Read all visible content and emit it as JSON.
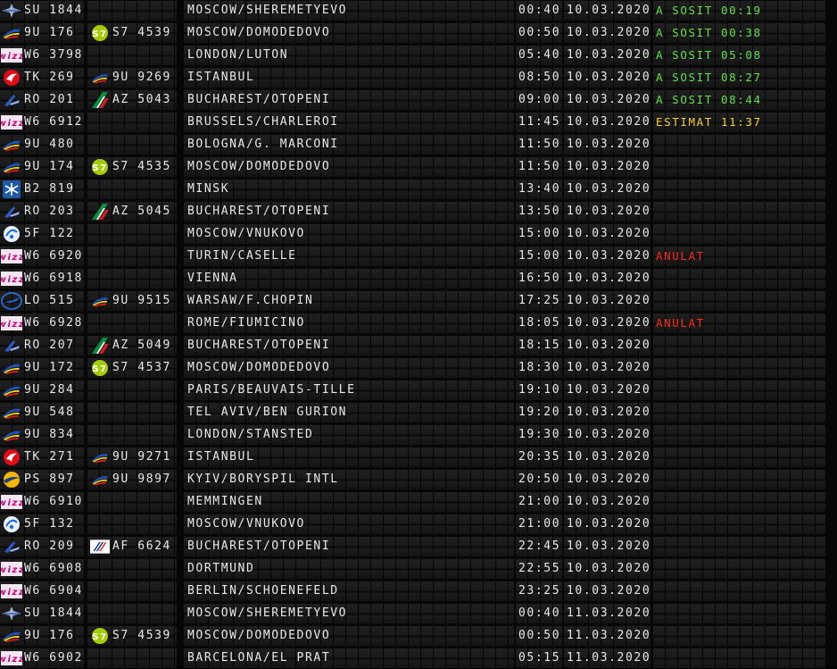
{
  "colors": {
    "text": "#e9e9e9",
    "status_landed": "#66e04a",
    "status_estimated": "#f2d23a",
    "status_cancelled": "#ff2a1a"
  },
  "flights": [
    {
      "flight": "SU 1844",
      "logo": "aeroflot-logo",
      "codeshare": "",
      "codeshare_logo": "",
      "destination": "MOSCOW/SHEREMETYEVO",
      "time": "00:40",
      "date": "10.03.2020",
      "status": "A SOSIT 00:19",
      "status_type": "landed"
    },
    {
      "flight": "9U 176",
      "logo": "air-moldova-logo",
      "codeshare": "S7 4539",
      "codeshare_logo": "s7-logo",
      "destination": "MOSCOW/DOMODEDOVO",
      "time": "00:50",
      "date": "10.03.2020",
      "status": "A SOSIT 00:38",
      "status_type": "landed"
    },
    {
      "flight": "W6 3798",
      "logo": "wizz-air-logo",
      "codeshare": "",
      "codeshare_logo": "",
      "destination": "LONDON/LUTON",
      "time": "05:40",
      "date": "10.03.2020",
      "status": "A SOSIT 05:08",
      "status_type": "landed"
    },
    {
      "flight": "TK 269",
      "logo": "turkish-airlines-logo",
      "codeshare": "9U 9269",
      "codeshare_logo": "air-moldova-logo",
      "destination": "ISTANBUL",
      "time": "08:50",
      "date": "10.03.2020",
      "status": "A SOSIT 08:27",
      "status_type": "landed"
    },
    {
      "flight": "RO 201",
      "logo": "tarom-logo",
      "codeshare": "AZ 5043",
      "codeshare_logo": "alitalia-logo",
      "destination": "BUCHAREST/OTOPENI",
      "time": "09:00",
      "date": "10.03.2020",
      "status": "A SOSIT 08:44",
      "status_type": "landed"
    },
    {
      "flight": "W6 6912",
      "logo": "wizz-air-logo",
      "codeshare": "",
      "codeshare_logo": "",
      "destination": "BRUSSELS/CHARLEROI",
      "time": "11:45",
      "date": "10.03.2020",
      "status": "ESTIMAT 11:37",
      "status_type": "estimated"
    },
    {
      "flight": "9U 480",
      "logo": "air-moldova-logo",
      "codeshare": "",
      "codeshare_logo": "",
      "destination": "BOLOGNA/G. MARCONI",
      "time": "11:50",
      "date": "10.03.2020",
      "status": "",
      "status_type": ""
    },
    {
      "flight": "9U 174",
      "logo": "air-moldova-logo",
      "codeshare": "S7 4535",
      "codeshare_logo": "s7-logo",
      "destination": "MOSCOW/DOMODEDOVO",
      "time": "11:50",
      "date": "10.03.2020",
      "status": "",
      "status_type": ""
    },
    {
      "flight": "B2 819",
      "logo": "belavia-logo",
      "codeshare": "",
      "codeshare_logo": "",
      "destination": "MINSK",
      "time": "13:40",
      "date": "10.03.2020",
      "status": "",
      "status_type": ""
    },
    {
      "flight": "RO 203",
      "logo": "tarom-logo",
      "codeshare": "AZ 5045",
      "codeshare_logo": "alitalia-logo",
      "destination": "BUCHAREST/OTOPENI",
      "time": "13:50",
      "date": "10.03.2020",
      "status": "",
      "status_type": ""
    },
    {
      "flight": "5F 122",
      "logo": "fly-one-logo",
      "codeshare": "",
      "codeshare_logo": "",
      "destination": "MOSCOW/VNUKOVO",
      "time": "15:00",
      "date": "10.03.2020",
      "status": "",
      "status_type": ""
    },
    {
      "flight": "W6 6920",
      "logo": "wizz-air-logo",
      "codeshare": "",
      "codeshare_logo": "",
      "destination": "TURIN/CASELLE",
      "time": "15:00",
      "date": "10.03.2020",
      "status": "ANULAT",
      "status_type": "cancelled"
    },
    {
      "flight": "W6 6918",
      "logo": "wizz-air-logo",
      "codeshare": "",
      "codeshare_logo": "",
      "destination": "VIENNA",
      "time": "16:50",
      "date": "10.03.2020",
      "status": "",
      "status_type": ""
    },
    {
      "flight": "LO 515",
      "logo": "lot-logo",
      "codeshare": "9U 9515",
      "codeshare_logo": "air-moldova-logo",
      "destination": "WARSAW/F.CHOPIN",
      "time": "17:25",
      "date": "10.03.2020",
      "status": "",
      "status_type": ""
    },
    {
      "flight": "W6 6928",
      "logo": "wizz-air-logo",
      "codeshare": "",
      "codeshare_logo": "",
      "destination": "ROME/FIUMICINO",
      "time": "18:05",
      "date": "10.03.2020",
      "status": "ANULAT",
      "status_type": "cancelled"
    },
    {
      "flight": "RO 207",
      "logo": "tarom-logo",
      "codeshare": "AZ 5049",
      "codeshare_logo": "alitalia-logo",
      "destination": "BUCHAREST/OTOPENI",
      "time": "18:15",
      "date": "10.03.2020",
      "status": "",
      "status_type": ""
    },
    {
      "flight": "9U 172",
      "logo": "air-moldova-logo",
      "codeshare": "S7 4537",
      "codeshare_logo": "s7-logo",
      "destination": "MOSCOW/DOMODEDOVO",
      "time": "18:30",
      "date": "10.03.2020",
      "status": "",
      "status_type": ""
    },
    {
      "flight": "9U 284",
      "logo": "air-moldova-logo",
      "codeshare": "",
      "codeshare_logo": "",
      "destination": "PARIS/BEAUVAIS-TILLE",
      "time": "19:10",
      "date": "10.03.2020",
      "status": "",
      "status_type": ""
    },
    {
      "flight": "9U 548",
      "logo": "air-moldova-logo",
      "codeshare": "",
      "codeshare_logo": "",
      "destination": "TEL AVIV/BEN GURION",
      "time": "19:20",
      "date": "10.03.2020",
      "status": "",
      "status_type": ""
    },
    {
      "flight": "9U 834",
      "logo": "air-moldova-logo",
      "codeshare": "",
      "codeshare_logo": "",
      "destination": "LONDON/STANSTED",
      "time": "19:30",
      "date": "10.03.2020",
      "status": "",
      "status_type": ""
    },
    {
      "flight": "TK 271",
      "logo": "turkish-airlines-logo",
      "codeshare": "9U 9271",
      "codeshare_logo": "air-moldova-logo",
      "destination": "ISTANBUL",
      "time": "20:35",
      "date": "10.03.2020",
      "status": "",
      "status_type": ""
    },
    {
      "flight": "PS 897",
      "logo": "uia-logo",
      "codeshare": "9U 9897",
      "codeshare_logo": "air-moldova-logo",
      "destination": "KYIV/BORYSPIL INTL",
      "time": "20:50",
      "date": "10.03.2020",
      "status": "",
      "status_type": ""
    },
    {
      "flight": "W6 6910",
      "logo": "wizz-air-logo",
      "codeshare": "",
      "codeshare_logo": "",
      "destination": "MEMMINGEN",
      "time": "21:00",
      "date": "10.03.2020",
      "status": "",
      "status_type": ""
    },
    {
      "flight": "5F 132",
      "logo": "fly-one-logo",
      "codeshare": "",
      "codeshare_logo": "",
      "destination": "MOSCOW/VNUKOVO",
      "time": "21:00",
      "date": "10.03.2020",
      "status": "",
      "status_type": ""
    },
    {
      "flight": "RO 209",
      "logo": "tarom-logo",
      "codeshare": "AF 6624",
      "codeshare_logo": "air-france-logo",
      "destination": "BUCHAREST/OTOPENI",
      "time": "22:45",
      "date": "10.03.2020",
      "status": "",
      "status_type": ""
    },
    {
      "flight": "W6 6908",
      "logo": "wizz-air-logo",
      "codeshare": "",
      "codeshare_logo": "",
      "destination": "DORTMUND",
      "time": "22:55",
      "date": "10.03.2020",
      "status": "",
      "status_type": ""
    },
    {
      "flight": "W6 6904",
      "logo": "wizz-air-logo",
      "codeshare": "",
      "codeshare_logo": "",
      "destination": "BERLIN/SCHOENEFELD",
      "time": "23:25",
      "date": "10.03.2020",
      "status": "",
      "status_type": ""
    },
    {
      "flight": "SU 1844",
      "logo": "aeroflot-logo",
      "codeshare": "",
      "codeshare_logo": "",
      "destination": "MOSCOW/SHEREMETYEVO",
      "time": "00:40",
      "date": "11.03.2020",
      "status": "",
      "status_type": ""
    },
    {
      "flight": "9U 176",
      "logo": "air-moldova-logo",
      "codeshare": "S7 4539",
      "codeshare_logo": "s7-logo",
      "destination": "MOSCOW/DOMODEDOVO",
      "time": "00:50",
      "date": "11.03.2020",
      "status": "",
      "status_type": ""
    },
    {
      "flight": "W6 6902",
      "logo": "wizz-air-logo",
      "codeshare": "",
      "codeshare_logo": "",
      "destination": "BARCELONA/EL PRAT",
      "time": "05:15",
      "date": "11.03.2020",
      "status": "",
      "status_type": ""
    }
  ]
}
